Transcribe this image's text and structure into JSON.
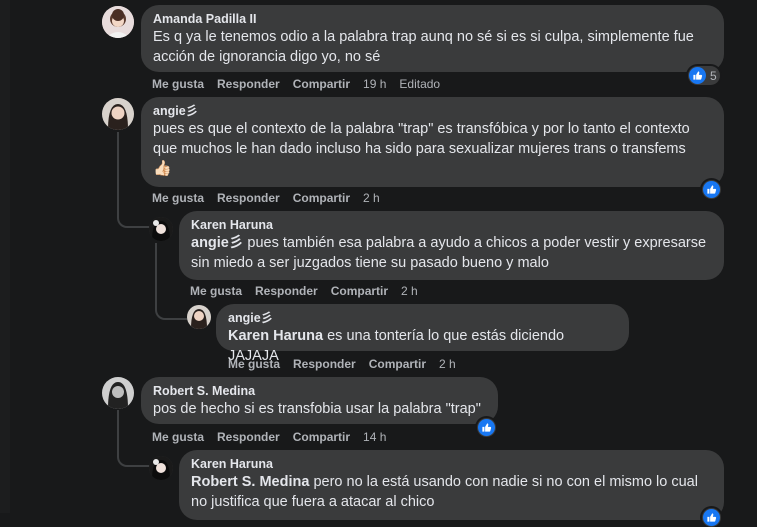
{
  "actions": {
    "like": "Me gusta",
    "reply": "Responder",
    "share": "Compartir"
  },
  "comments": [
    {
      "name": "Amanda Padilla II",
      "text": "Es q ya le tenemos odio a la palabra trap aunq no sé si es si culpa, simplemente fue acción de ignorancia digo yo, no sé",
      "time": "19 h",
      "edited": "Editado",
      "reactions": "5"
    },
    {
      "name": "angie彡",
      "text": "pues es que el contexto de la palabra \"trap\" es transfóbica y por lo tanto el contexto que muchos le han dado incluso ha sido para sexualizar mujeres trans o transfems",
      "emoji": "👍🏻",
      "time": "2 h"
    },
    {
      "name": "Karen Haruna",
      "tag": "angie彡",
      "text": " pues también esa palabra a ayudo a chicos a poder vestir y expresarse sin miedo a ser juzgados tiene su pasado bueno y malo",
      "time": "2 h"
    },
    {
      "name": "angie彡",
      "tag": "Karen Haruna",
      "text": " es una tontería lo que estás diciendo JAJAJA",
      "time": "2 h"
    },
    {
      "name": "Robert S. Medina",
      "text": "pos de hecho si es transfobia usar la palabra \"trap\"",
      "time": "14 h"
    },
    {
      "name": "Karen Haruna",
      "tag": "Robert S. Medina",
      "text": " pero no la está usando con nadie si no con el mismo lo cual no justifica que fuera a atacar al chico"
    }
  ]
}
